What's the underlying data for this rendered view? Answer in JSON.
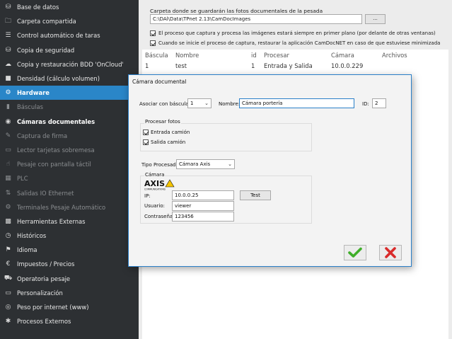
{
  "sidebar": {
    "items": [
      {
        "label": "Base de datos",
        "icon": "database-icon",
        "state": "normal"
      },
      {
        "label": "Carpeta compartida",
        "icon": "folder-icon",
        "state": "normal"
      },
      {
        "label": "Control automático de taras",
        "icon": "list-icon",
        "state": "normal"
      },
      {
        "label": "Copia de seguridad",
        "icon": "backup-icon",
        "state": "normal"
      },
      {
        "label": "Copia y restauración BDD 'OnCloud'",
        "icon": "cloud-icon",
        "state": "normal"
      },
      {
        "label": "Densidad (cálculo volumen)",
        "icon": "tank-icon",
        "state": "normal"
      },
      {
        "label": "Hardware",
        "icon": "gear-icon",
        "state": "active"
      },
      {
        "label": "Básculas",
        "icon": "scale-icon",
        "state": "sub"
      },
      {
        "label": "Cámaras documentales",
        "icon": "camera-icon",
        "state": "bold"
      },
      {
        "label": "Captura de firma",
        "icon": "signature-icon",
        "state": "sub"
      },
      {
        "label": "Lector tarjetas sobremesa",
        "icon": "card-reader-icon",
        "state": "sub"
      },
      {
        "label": "Pesaje con pantalla táctil",
        "icon": "touch-icon",
        "state": "sub"
      },
      {
        "label": "PLC",
        "icon": "plc-icon",
        "state": "sub"
      },
      {
        "label": "Salidas IO Ethernet",
        "icon": "io-icon",
        "state": "sub"
      },
      {
        "label": "Terminales Pesaje Automático",
        "icon": "terminal-gear-icon",
        "state": "sub"
      },
      {
        "label": "Herramientas Externas",
        "icon": "toolbox-icon",
        "state": "normal"
      },
      {
        "label": "Históricos",
        "icon": "history-icon",
        "state": "normal"
      },
      {
        "label": "Idioma",
        "icon": "flag-icon",
        "state": "normal"
      },
      {
        "label": "Impuestos / Precios",
        "icon": "euro-icon",
        "state": "normal"
      },
      {
        "label": "Operatoria pesaje",
        "icon": "truck-icon",
        "state": "normal"
      },
      {
        "label": "Personalización",
        "icon": "monitor-icon",
        "state": "normal"
      },
      {
        "label": "Peso por internet (www)",
        "icon": "globe-icon",
        "state": "normal"
      },
      {
        "label": "Procesos Externos",
        "icon": "puzzle-icon",
        "state": "normal"
      }
    ]
  },
  "main": {
    "folder_label": "Carpeta donde se guardarán las fotos documentales de la pesada",
    "folder_path": "C:\\DAl\\Data\\TPnet 2.13\\CamDocImages",
    "browse_label": "...",
    "option_foreground": "El proceso que captura y procesa las imágenes estará siempre en primer plano (por delante de otras ventanas)",
    "option_restore": "Cuando se inicie el proceso de captura, restaurar la aplicación CamDocNET en caso de que estuviese minimizada",
    "table": {
      "headers": [
        "Báscula",
        "Nombre",
        "id",
        "Procesar",
        "Cámara",
        "Archivos"
      ],
      "rows": [
        [
          "1",
          "test",
          "1",
          "Entrada y Salida",
          "10.0.0.229",
          ""
        ]
      ]
    }
  },
  "dialog": {
    "title": "Cámara documental",
    "scale_label": "Asociar con báscula:",
    "scale_value": "1",
    "name_label": "Nombre:",
    "name_value": "Cámara portería",
    "id_label": "ID:",
    "id_value": "2",
    "process_group_title": "Procesar fotos",
    "entry_label": "Entrada camión",
    "exit_label": "Salida camión",
    "process_type_label": "Tipo Procesado",
    "process_type_value": "Cámara Axis",
    "camera_group_title": "Cámara",
    "axis_logo_text": "AXIS",
    "axis_logo_sub": "COMMUNICATIONS",
    "ip_label": "IP:",
    "ip_value": "10.0.0.25",
    "test_label": "Test",
    "user_label": "Usuario:",
    "user_value": "viewer",
    "password_label": "Contraseña:",
    "password_value": "123456"
  },
  "colors": {
    "sidebar_bg": "#2d3033",
    "active_bg": "#2a86c8",
    "accept_green": "#3fae2a",
    "cancel_red": "#d92b2b",
    "axis_yellow": "#f5c400"
  }
}
